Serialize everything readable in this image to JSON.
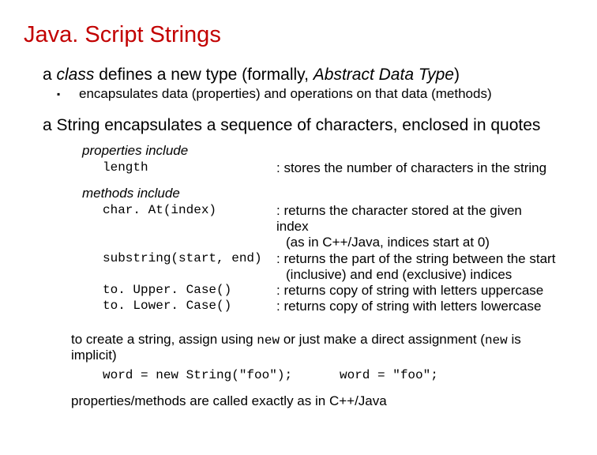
{
  "title": "Java. Script Strings",
  "p1_pre": "a ",
  "p1_class": "class",
  "p1_mid": " defines a new type (formally, ",
  "p1_adt": "Abstract Data Type",
  "p1_post": ")",
  "sub1": "encapsulates data (properties) and operations on that data (methods)",
  "p2": "a String encapsulates a sequence of characters, enclosed in quotes",
  "props_head": "properties include",
  "prop_length_code": "length",
  "prop_length_desc": ": stores the number of characters in the string",
  "methods_head": "methods include",
  "m_charAt_code": "char. At(index)",
  "m_charAt_desc1": ": returns the character stored at the given index",
  "m_charAt_desc2": "(as in C++/Java, indices start at 0)",
  "m_substr_code": "substring(start, end)",
  "m_substr_desc1": ": returns the part of the string between the start",
  "m_substr_desc2": "(inclusive) and end (exclusive) indices",
  "m_upper_code": "to. Upper. Case()",
  "m_upper_desc": ": returns copy of string with letters uppercase",
  "m_lower_code": "to. Lower. Case()",
  "m_lower_desc": ": returns copy of string with letters lowercase",
  "p3_a": "to create a string, assign using ",
  "p3_new1": "new",
  "p3_b": " or just make a direct assignment (",
  "p3_new2": "new",
  "p3_c": " is implicit)",
  "code_left": "word = new String(\"foo\");",
  "code_right": "word = \"foo\";",
  "p4": "properties/methods are called exactly as in C++/Java"
}
